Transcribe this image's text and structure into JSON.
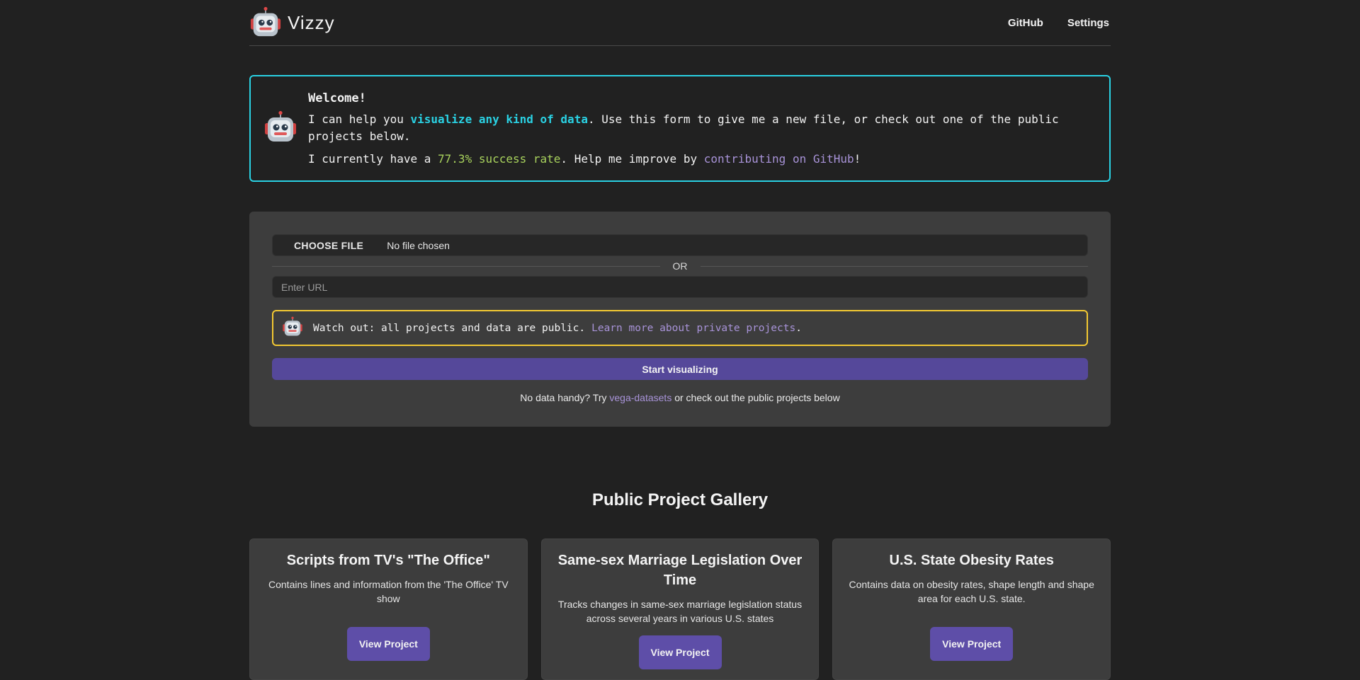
{
  "header": {
    "brand_name": "Vizzy",
    "nav": {
      "github": "GitHub",
      "settings": "Settings"
    }
  },
  "welcome": {
    "title": "Welcome!",
    "line1_pre": "I can help you ",
    "line1_highlight": "visualize any kind of data",
    "line1_post": ". Use this form to give me a new file, or check out one of the public projects below.",
    "line2_pre": "I currently have a ",
    "line2_rate": "77.3% success rate",
    "line2_mid": ". Help me improve by ",
    "line2_link": "contributing on GitHub",
    "line2_post": "!"
  },
  "form": {
    "choose_file_label": "CHOOSE FILE",
    "file_status": "No file chosen",
    "or_label": "OR",
    "url_placeholder": "Enter URL",
    "warning_text": "Watch out: all projects and data are public. ",
    "warning_link": "Learn more about private projects",
    "warning_end": ".",
    "start_label": "Start visualizing",
    "hint_pre": "No data handy? Try ",
    "hint_link": "vega-datasets",
    "hint_post": " or check out the public projects below"
  },
  "gallery": {
    "title": "Public Project Gallery",
    "projects": [
      {
        "title": "Scripts from TV's \"The Office\"",
        "description": "Contains lines and information from the 'The Office' TV show",
        "button": "View Project"
      },
      {
        "title": "Same-sex Marriage Legislation Over Time",
        "description": "Tracks changes in same-sex marriage legislation status across several years in various U.S. states",
        "button": "View Project"
      },
      {
        "title": "U.S. State Obesity Rates",
        "description": "Contains data on obesity rates, shape length and shape area for each U.S. state.",
        "button": "View Project"
      }
    ]
  },
  "colors": {
    "background": "#212121",
    "card": "#3d3d3d",
    "accent_cyan": "#2ad1e3",
    "accent_yellow": "#f2c832",
    "accent_purple": "#55489a",
    "success_green": "#a9d35d",
    "link_purple": "#a893d8"
  },
  "icons": {
    "logo": "robot-icon"
  }
}
